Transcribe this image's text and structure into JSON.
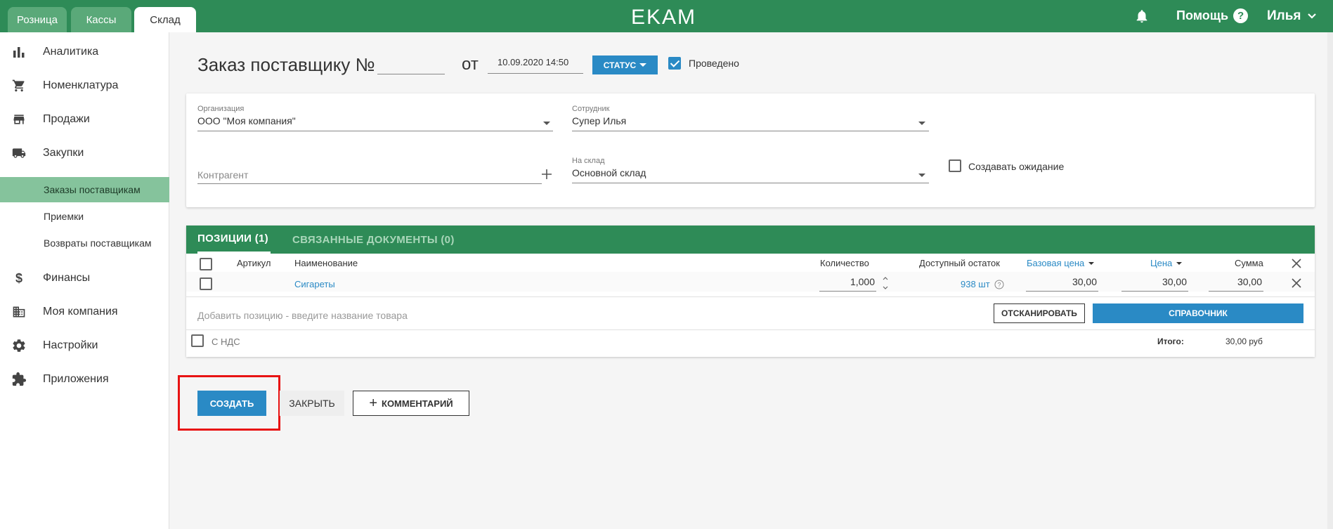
{
  "top_tabs": [
    {
      "label": "Розница"
    },
    {
      "label": "Кассы"
    },
    {
      "label": "Склад"
    }
  ],
  "brand": {
    "logo": "EKAM",
    "primary_color": "#2e8b57",
    "accent_color": "#2a8ac5"
  },
  "header_right": {
    "help_label": "Помощь",
    "help_glyph": "?",
    "user_name": "Илья"
  },
  "sidebar": {
    "items": [
      {
        "label": "Аналитика",
        "icon": "bar-chart-icon"
      },
      {
        "label": "Номенклатура",
        "icon": "cart-icon"
      },
      {
        "label": "Продажи",
        "icon": "store-icon"
      },
      {
        "label": "Закупки",
        "icon": "truck-icon"
      }
    ],
    "sub_items": [
      {
        "label": "Заказы поставщикам",
        "active": true
      },
      {
        "label": "Приемки"
      },
      {
        "label": "Возвраты поставщикам"
      }
    ],
    "items_bottom": [
      {
        "label": "Финансы",
        "icon": "dollar-icon"
      },
      {
        "label": "Моя компания",
        "icon": "building-icon"
      },
      {
        "label": "Настройки",
        "icon": "gear-icon"
      },
      {
        "label": "Приложения",
        "icon": "puzzle-icon"
      }
    ]
  },
  "document": {
    "title": "Заказ поставщику  №",
    "number": "",
    "from_label": "от",
    "date": "10.09.2020 14:50",
    "status_label": "СТАТУС",
    "posted_label": "Проведено",
    "posted": true
  },
  "form": {
    "organization_label": "Организация",
    "organization_value": "ООО \"Моя компания\"",
    "employee_label": "Сотрудник",
    "employee_value": "Супер Илья",
    "counterparty_placeholder": "Контрагент",
    "counterparty_add": "+",
    "warehouse_label": "На склад",
    "warehouse_value": "Основной склад",
    "create_waiting_label": "Создавать ожидание"
  },
  "positions": {
    "tabs": [
      {
        "label": "ПОЗИЦИИ (1)",
        "active": true
      },
      {
        "label": "СВЯЗАННЫЕ ДОКУМЕНТЫ (0)",
        "active": false
      }
    ],
    "columns": {
      "article": "Артикул",
      "name": "Наименование",
      "quantity": "Количество",
      "available": "Доступный остаток",
      "base_price": "Базовая цена",
      "price": "Цена",
      "sum": "Сумма"
    },
    "rows": [
      {
        "article": "",
        "name": "Сигареты",
        "quantity": "1,000",
        "available": "938 шт",
        "base_price": "30,00",
        "price": "30,00",
        "sum": "30,00"
      }
    ],
    "add_placeholder": "Добавить позицию - введите название товара",
    "scan_label": "ОТСКАНИРОВАТЬ",
    "directory_label": "СПРАВОЧНИК",
    "vat_label": "С НДС",
    "total_label": "Итого:",
    "total_value": "30,00 руб"
  },
  "actions": {
    "create_label": "СОЗДАТЬ",
    "close_label": "ЗАКРЫТЬ",
    "comment_label": "КОММЕНТАРИЙ",
    "comment_glyph": "+"
  },
  "highlight_color": "#e81313"
}
